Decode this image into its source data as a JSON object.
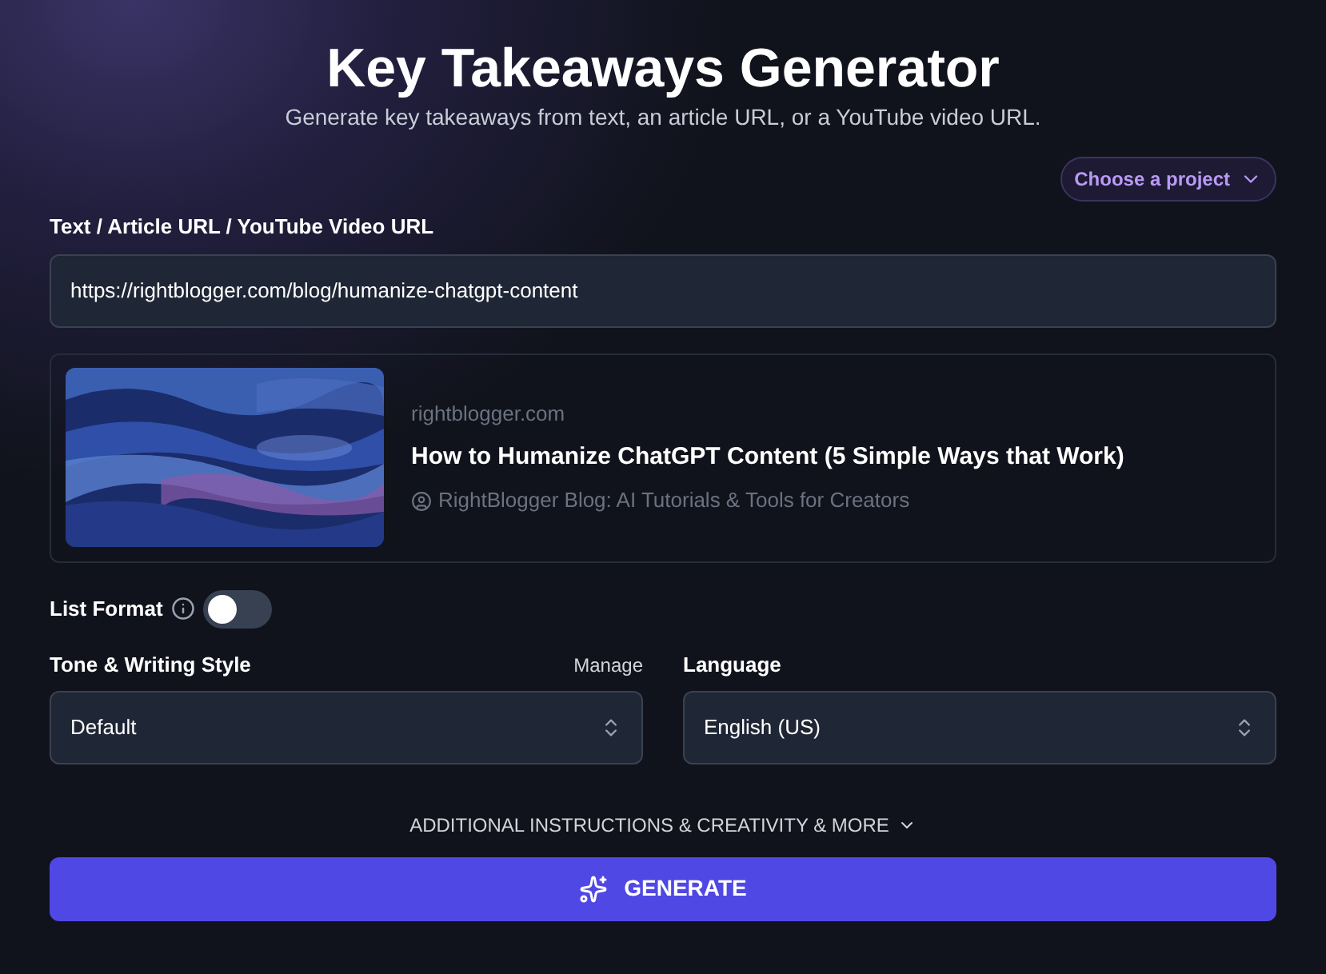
{
  "header": {
    "title": "Key Takeaways Generator",
    "subtitle": "Generate key takeaways from text, an article URL, or a YouTube video URL."
  },
  "project_picker": {
    "label": "Choose a project"
  },
  "source": {
    "label": "Text / Article URL / YouTube Video URL",
    "value": "https://rightblogger.com/blog/humanize-chatgpt-content"
  },
  "preview": {
    "domain": "rightblogger.com",
    "title": "How to Humanize ChatGPT Content (5 Simple Ways that Work)",
    "site": "RightBlogger Blog: AI Tutorials & Tools for Creators"
  },
  "list_format": {
    "label": "List Format",
    "on": false
  },
  "tone": {
    "label": "Tone & Writing Style",
    "manage": "Manage",
    "value": "Default"
  },
  "language": {
    "label": "Language",
    "value": "English (US)"
  },
  "more_toggle": {
    "label": "ADDITIONAL INSTRUCTIONS & CREATIVITY & MORE",
    "expanded": false
  },
  "generate": {
    "label": "GENERATE"
  }
}
